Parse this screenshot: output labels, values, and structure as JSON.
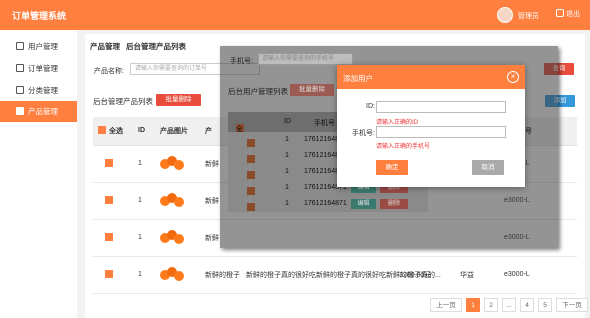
{
  "app": {
    "title": "订单管理系统",
    "user": "管理员",
    "logout": "退出"
  },
  "sidebar": {
    "items": [
      {
        "label": "用户管理",
        "icon": "user-icon"
      },
      {
        "label": "订单管理",
        "icon": "order-icon"
      },
      {
        "label": "分类管理",
        "icon": "category-icon"
      },
      {
        "label": "产品管理",
        "icon": "product-icon"
      }
    ]
  },
  "main": {
    "breadcrumb": [
      "产品管理",
      "后台管理产品列表"
    ],
    "search_label": "产品名称:",
    "search_placeholder": "请输入你需要查询的订单号",
    "search_button": "查询",
    "list_title": "后台管理产品列表",
    "batch_delete": "批量删除",
    "add_button": "添加",
    "columns": [
      "全选",
      "ID",
      "产品图片",
      "产",
      "产品型号"
    ],
    "rows": [
      {
        "id": "1",
        "name": "新鲜",
        "model": "e3000-L"
      },
      {
        "id": "1",
        "name": "新鲜",
        "model": "e3000-L"
      },
      {
        "id": "1",
        "name": "新鲜",
        "model": "e3000-L"
      },
      {
        "id": "1",
        "name": "新鲜的橙子",
        "desc": "新鲜的橙子真的很好吃新鲜的橙子真的很好吃新鲜的橙子真的...",
        "price": "1200.00元",
        "origin": "华益",
        "model": "e3000-L"
      }
    ],
    "pager": [
      "上一页",
      "1",
      "2",
      "...",
      "4",
      "5",
      "下一页"
    ]
  },
  "overlay": {
    "phone_label": "手机号:",
    "phone_placeholder": "请输入你需要查询的手机号",
    "list_title": "后台用户管理列表",
    "batch_delete": "批量删除",
    "columns": [
      "全选",
      "ID",
      "手机号"
    ],
    "rows": [
      {
        "id": "1",
        "phone": "17612164871"
      },
      {
        "id": "1",
        "phone": "17612164871"
      },
      {
        "id": "1",
        "phone": "17612164871"
      },
      {
        "id": "1",
        "phone": "17612164871",
        "edit": "编辑",
        "delete": "删除"
      },
      {
        "id": "1",
        "phone": "17612164871",
        "edit": "编辑",
        "delete": "删除"
      }
    ]
  },
  "dialog": {
    "title": "添加用户",
    "id_label": "ID:",
    "id_error": "请输入正确的ID",
    "phone_label": "手机号:",
    "phone_error": "请输入正确的手机号",
    "ok": "确定",
    "cancel": "取消"
  },
  "colors": {
    "accent": "#ff7f3f",
    "danger": "#e74c3c",
    "info": "#3498db"
  }
}
